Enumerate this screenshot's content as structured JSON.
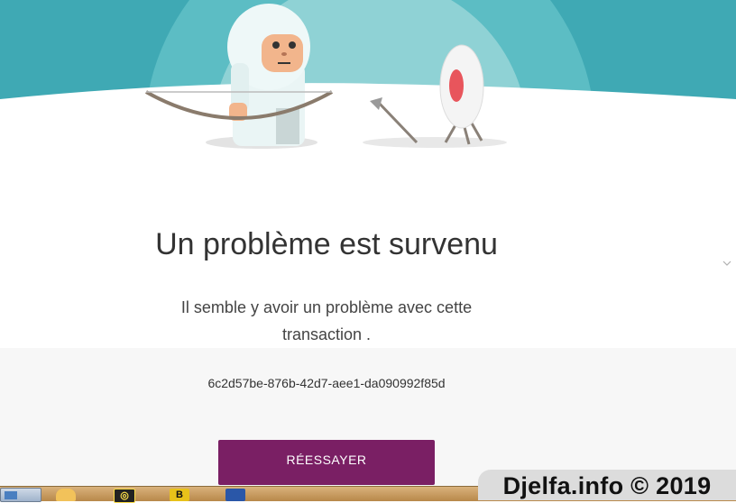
{
  "colors": {
    "sky_teal": "#3fa9b4",
    "primary_button": "#7a1f64",
    "title_text": "#333333",
    "panel_bg": "#f7f7f7"
  },
  "illustration": {
    "description_icons": [
      "yeti-archer-icon",
      "archery-target-icon",
      "fallen-arrow-icon"
    ]
  },
  "error": {
    "title": "Un problème est survenu",
    "message": "Il semble y avoir un problème avec cette transaction .",
    "transaction_id": "6c2d57be-876b-42d7-aee1-da090992f85d",
    "retry_label": "RÉESSAYER"
  },
  "taskbar": {
    "icons": [
      "start-button",
      "folder-icon",
      "media-player-icon",
      "app-icon",
      "document-icon"
    ]
  },
  "watermark": {
    "text": "Djelfa.info © 2019"
  }
}
